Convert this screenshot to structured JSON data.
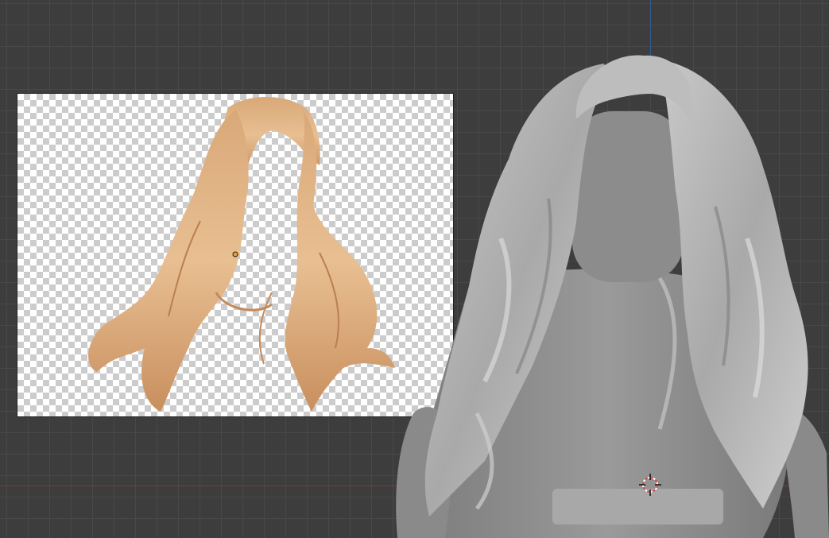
{
  "viewport": {
    "background_color": "#3d3d3d",
    "grid_color": "#505050",
    "x_axis_color": "#8a3a3a",
    "y_axis_color": "#2f5f9a"
  },
  "reference_image": {
    "content": "hair-reference",
    "hair_color": "#d9a878"
  },
  "model": {
    "content": "avatar-with-long-wavy-hair",
    "shade_color": "#9a9a9a"
  },
  "cursor": {
    "icon": "3d-cursor-icon",
    "ring_color": "#e04a4a"
  }
}
